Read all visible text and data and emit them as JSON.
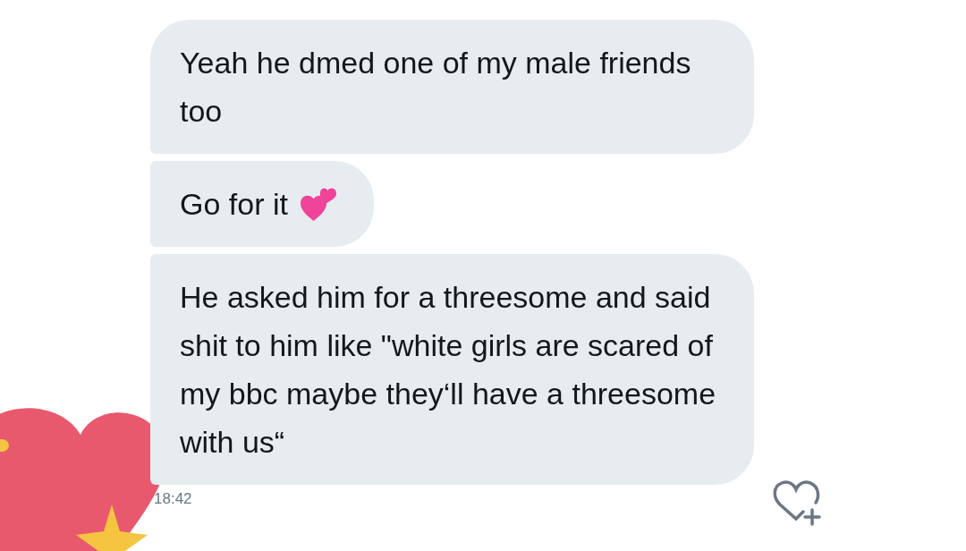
{
  "messages": [
    {
      "text": "Yeah he dmed one of my male friends too",
      "hearts_emoji": false
    },
    {
      "text": "Go for it",
      "hearts_emoji": true
    },
    {
      "text": "He asked him for a threesome and said shit to him like \"white girls are scared of my bbc maybe they‘ll have a threesome with us“",
      "hearts_emoji": false
    }
  ],
  "timestamp": "18:42"
}
